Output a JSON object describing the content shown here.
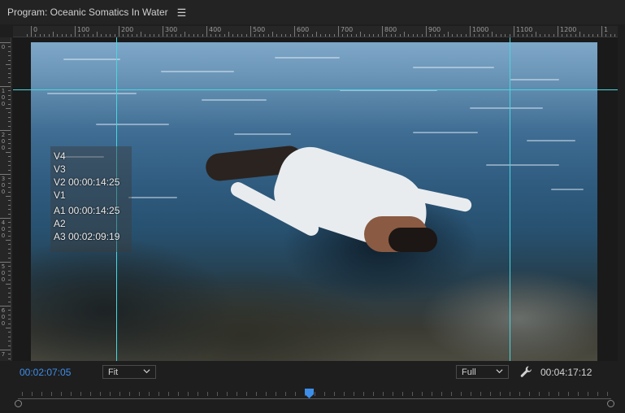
{
  "panel": {
    "title": "Program: Oceanic Somatics In Water",
    "menu_icon": "hamburger-menu-icon"
  },
  "ruler_h": {
    "labels": [
      "0",
      "100",
      "200",
      "300",
      "400",
      "500",
      "600",
      "700",
      "800",
      "900",
      "1000",
      "1100",
      "1200",
      "1"
    ]
  },
  "ruler_v": {
    "labels": [
      "0",
      "1\n0\n0",
      "2\n0\n0",
      "3\n0\n0",
      "4\n0\n0",
      "5\n0\n0",
      "6\n0\n0",
      "7"
    ]
  },
  "track_overlay": [
    "V4",
    "V3",
    "V2 00:00:14:25",
    "V1",
    "A1 00:00:14:25",
    "A2",
    "A3 00:02:09:19"
  ],
  "controls": {
    "playhead_timecode": "00:02:07:05",
    "zoom_value": "Fit",
    "resolution_value": "Full",
    "duration_timecode": "00:04:17:12",
    "settings_icon": "wrench-icon"
  },
  "colors": {
    "accent_blue": "#3d8ee9",
    "guide_cyan": "#48d7e0"
  }
}
